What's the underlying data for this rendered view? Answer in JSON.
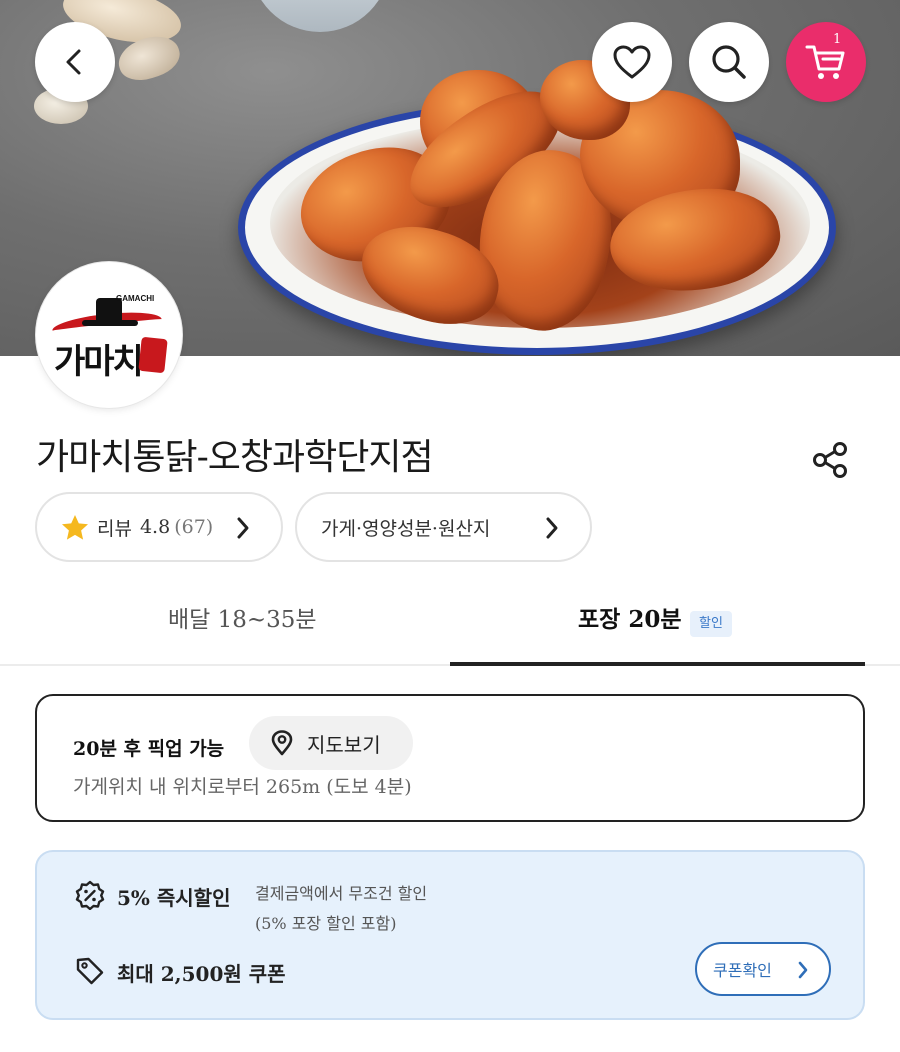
{
  "store": {
    "name": "가마치통닭-오창과학단지점",
    "logo_text_en": "GAMACHI",
    "logo_text_ko": "가마치"
  },
  "header": {
    "cart_count": "1"
  },
  "pills": {
    "review_label": "리뷰",
    "review_rating": "4.8",
    "review_count": "(67)",
    "info_label": "가게·영양성분·원산지"
  },
  "tabs": {
    "delivery": "배달 18~35분",
    "pickup": "포장 20분",
    "pickup_badge": "할인"
  },
  "pickup": {
    "ready_text": "20분 후 픽업 가능",
    "map_button": "지도보기",
    "distance_text": "가게위치 내 위치로부터 265m (도보 4분)"
  },
  "discount": {
    "instant_label": "5% 즉시할인",
    "instant_desc_line1": "결제금액에서 무조건 할인",
    "instant_desc_line2": "(5% 포장 할인 포함)",
    "coupon_label": "최대 2,500원 쿠폰",
    "coupon_button": "쿠폰확인"
  },
  "colors": {
    "accent_pink": "#ea2d6b",
    "accent_blue": "#2f6eb8",
    "star_yellow": "#f5b81f"
  },
  "icons": [
    "back-icon",
    "heart-icon",
    "search-icon",
    "cart-icon",
    "share-icon",
    "star-icon",
    "chevron-right-icon",
    "location-pin-icon",
    "percent-badge-icon",
    "tag-icon"
  ]
}
